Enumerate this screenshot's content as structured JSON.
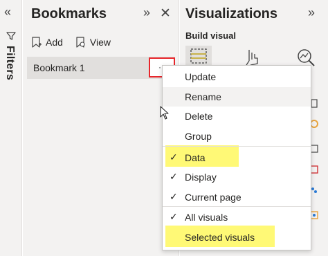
{
  "filters": {
    "collapse_glyph": "«",
    "label": "Filters",
    "funnel_icon": "funnel-icon"
  },
  "bookmarks": {
    "title": "Bookmarks",
    "expand_glyph": "»",
    "close_glyph": "✕",
    "add_label": "Add",
    "view_label": "View",
    "items": [
      {
        "label": "Bookmark 1",
        "more_glyph": "·"
      }
    ]
  },
  "visualizations": {
    "title": "Visualizations",
    "expand_glyph": "»",
    "subtitle": "Build visual"
  },
  "context_menu": {
    "items": [
      {
        "label": "Update",
        "checked": false
      },
      {
        "label": "Rename",
        "checked": false
      },
      {
        "label": "Delete",
        "checked": false
      },
      {
        "label": "Group",
        "checked": false
      },
      {
        "label": "Data",
        "checked": true
      },
      {
        "label": "Display",
        "checked": true
      },
      {
        "label": "Current page",
        "checked": true
      },
      {
        "label": "All visuals",
        "checked": true
      },
      {
        "label": "Selected visuals",
        "checked": false
      }
    ],
    "check_glyph": "✓",
    "hovered_item": "Rename",
    "highlighted_items": [
      "Data",
      "Selected visuals"
    ]
  },
  "colors": {
    "pane_bg": "#f3f2f1",
    "selected_item_bg": "#e1dfdd",
    "annotation_box": "#e8262b",
    "annotation_highlight": "#fff85e",
    "menu_bg": "#ffffff"
  }
}
